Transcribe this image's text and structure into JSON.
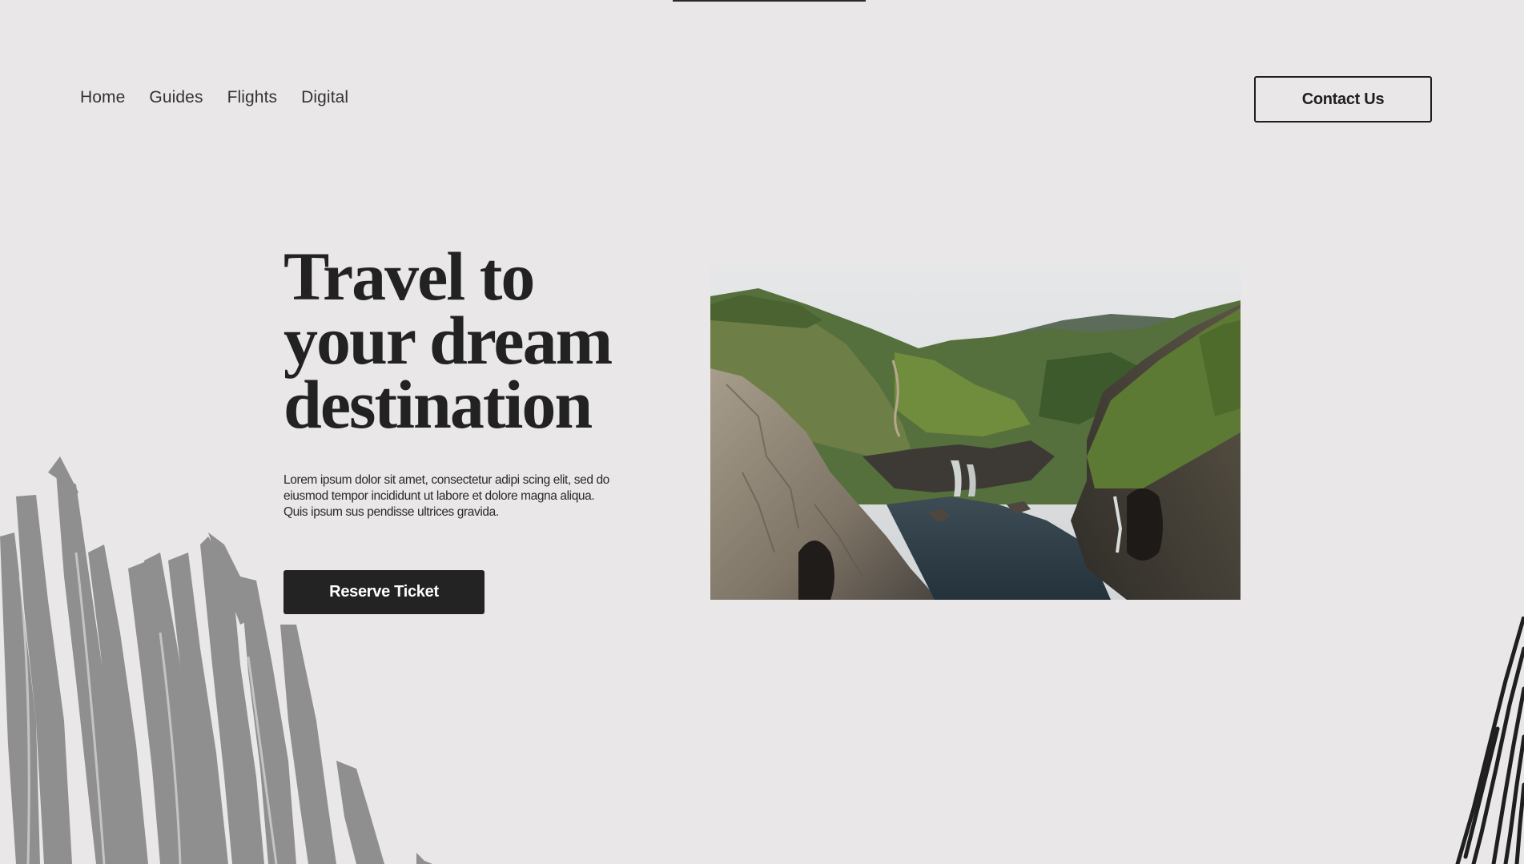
{
  "nav": {
    "items": [
      {
        "label": "Home"
      },
      {
        "label": "Guides"
      },
      {
        "label": "Flights"
      },
      {
        "label": "Digital"
      }
    ]
  },
  "header": {
    "contact_label": "Contact Us"
  },
  "hero": {
    "title_lines": [
      "Travel to",
      "your dream",
      "destination"
    ],
    "description_lines": [
      "Lorem ipsum dolor sit amet, consectetur adipi scing elit, sed do",
      "eiusmod tempor incididunt ut labore et dolore magna aliqua.",
      "Quis ipsum sus pendisse ultrices gravida."
    ],
    "reserve_label": "Reserve Ticket"
  },
  "colors": {
    "background": "#e9e7e7",
    "text": "#222222",
    "button_dark": "#232323",
    "scribble_gray": "#8f8f8f",
    "scribble_dark": "#1f1f1f"
  },
  "images": {
    "hero": "coastal-cove-photo"
  }
}
